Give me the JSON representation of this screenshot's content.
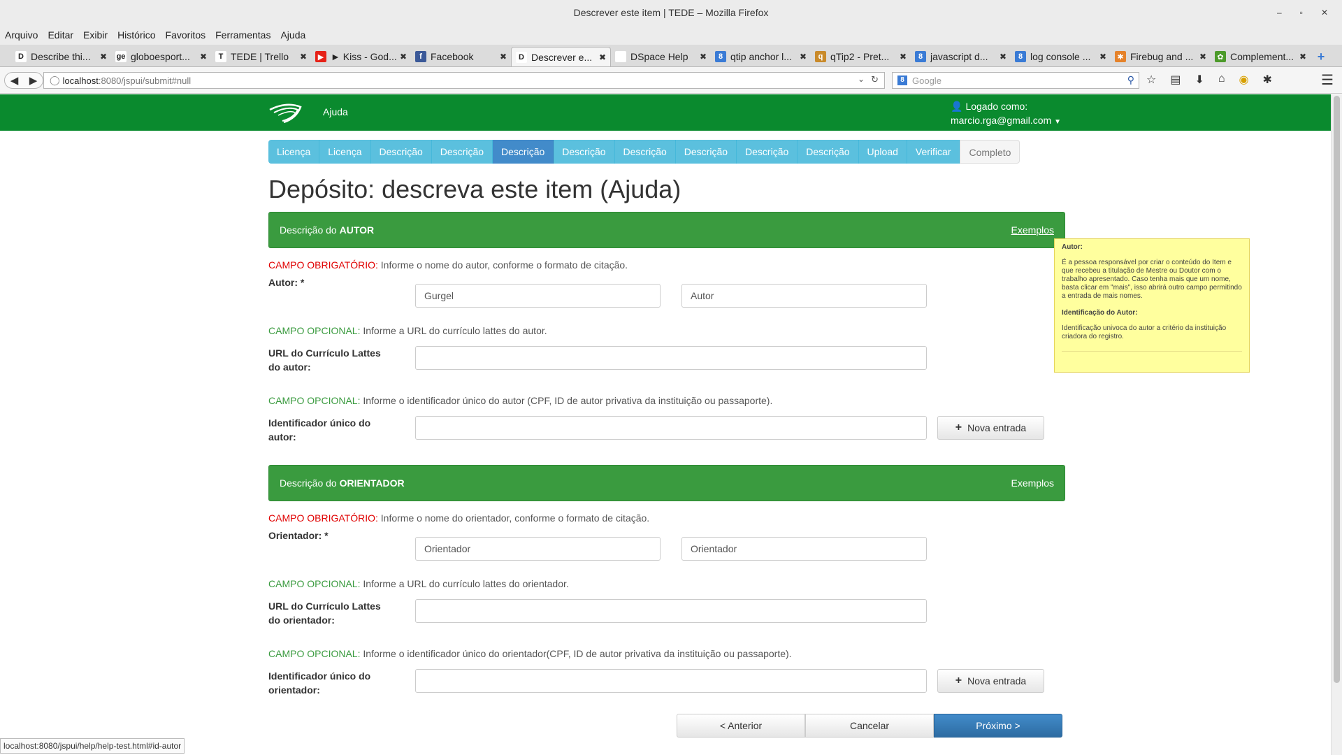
{
  "window": {
    "title": "Descrever este item | TEDE – Mozilla Firefox",
    "controls": [
      "–",
      "▫",
      "✕"
    ]
  },
  "menu": [
    "Arquivo",
    "Editar",
    "Exibir",
    "Histórico",
    "Favoritos",
    "Ferramentas",
    "Ajuda"
  ],
  "tabs": [
    {
      "label": "Describe thi...",
      "icon": "D",
      "color": "#ffffff"
    },
    {
      "label": "globoesport...",
      "icon": "ge",
      "color": "#ffffff"
    },
    {
      "label": "TEDE | Trello",
      "icon": "T",
      "color": "#ffffff"
    },
    {
      "label": "► Kiss - God...",
      "icon": "▶",
      "color": "#e62117"
    },
    {
      "label": "Facebook",
      "icon": "f",
      "color": "#3b5998"
    },
    {
      "label": "Descrever e...",
      "icon": "D",
      "color": "#ffffff"
    },
    {
      "label": "DSpace Help",
      "icon": "",
      "color": "#ffffff"
    },
    {
      "label": "qtip anchor l...",
      "icon": "8",
      "color": "#3a7bd5"
    },
    {
      "label": "qTip2 - Pret...",
      "icon": "q",
      "color": "#c98a2a"
    },
    {
      "label": "javascript d...",
      "icon": "8",
      "color": "#3a7bd5"
    },
    {
      "label": "log console ...",
      "icon": "8",
      "color": "#3a7bd5"
    },
    {
      "label": "Firebug and ...",
      "icon": "✱",
      "color": "#e5822a"
    },
    {
      "label": "Complement...",
      "icon": "✿",
      "color": "#4c9a2a"
    }
  ],
  "url": {
    "host": "localhost",
    "rest": ":8080/jspui/submit#null"
  },
  "search": {
    "placeholder": "Google"
  },
  "header": {
    "help": "Ajuda",
    "logged_as": "Logado como:",
    "email": "marcio.rga@gmail.com"
  },
  "steps": [
    "Licença",
    "Licença",
    "Descrição",
    "Descrição",
    "Descrição",
    "Descrição",
    "Descrição",
    "Descrição",
    "Descrição",
    "Descrição",
    "Upload",
    "Verificar",
    "Completo"
  ],
  "page_title": "Depósito: descreva este item (Ajuda)",
  "author_section": {
    "head_prefix": "Descrição do ",
    "head_bold": "AUTOR",
    "examples": "Exemplos",
    "req_tag": "CAMPO OBRIGATÓRIO:",
    "req_text": " Informe o nome do autor, conforme o formato de citação.",
    "name_label": "Autor: *",
    "name_value_1": "Gurgel",
    "name_value_2": "Autor",
    "opt_tag": "CAMPO OPCIONAL:",
    "lattes_text": " Informe a URL do currículo lattes do autor.",
    "lattes_label": "URL do Currículo Lattes do autor:",
    "id_text": " Informe o identificador único do autor (CPF, ID de autor privativa da instituição ou passaporte).",
    "id_label": "Identificador único do autor:",
    "add_button": "Nova entrada"
  },
  "advisor_section": {
    "head_prefix": "Descrição do ",
    "head_bold": "ORIENTADOR",
    "examples": "Exemplos",
    "req_tag": "CAMPO OBRIGATÓRIO:",
    "req_text": " Informe o nome do orientador, conforme o formato de citação.",
    "name_label": "Orientador: *",
    "name_value_1": "Orientador",
    "name_value_2": "Orientador",
    "opt_tag": "CAMPO OPCIONAL:",
    "lattes_text": " Informe a URL do currículo lattes do orientador.",
    "lattes_label": "URL do Currículo Lattes do orientador:",
    "id_text": " Informe o identificador único do orientador(CPF, ID de autor privativa da instituição ou passaporte).",
    "id_label": "Identificador único do orientador:",
    "add_button": "Nova entrada"
  },
  "nav": {
    "prev": "< Anterior",
    "cancel": "Cancelar",
    "next": "Próximo >"
  },
  "help_tip": {
    "title": "Autor:",
    "body": "É a pessoa responsável por criar o conteúdo do Item e que recebeu a titulação de Mestre ou Doutor com o trabalho apresentado. Caso tenha mais que um nome, basta clicar em \"mais\", isso abrirá outro campo permitindo a entrada de mais nomes.",
    "subtitle": "Identificação do Autor:",
    "body2": "Identificação univoca do autor a critério da instituição criadora do registro."
  },
  "status_url": "localhost:8080/jspui/help/help-test.html#id-autor",
  "colors": {
    "header_green": "#0a8a2e",
    "section_green": "#3a9b3f",
    "step_blue": "#5bc0de",
    "step_current": "#428bca",
    "required_red": "#e00000",
    "primary_button": "#428bca",
    "tooltip_yellow": "#ffff9e"
  }
}
